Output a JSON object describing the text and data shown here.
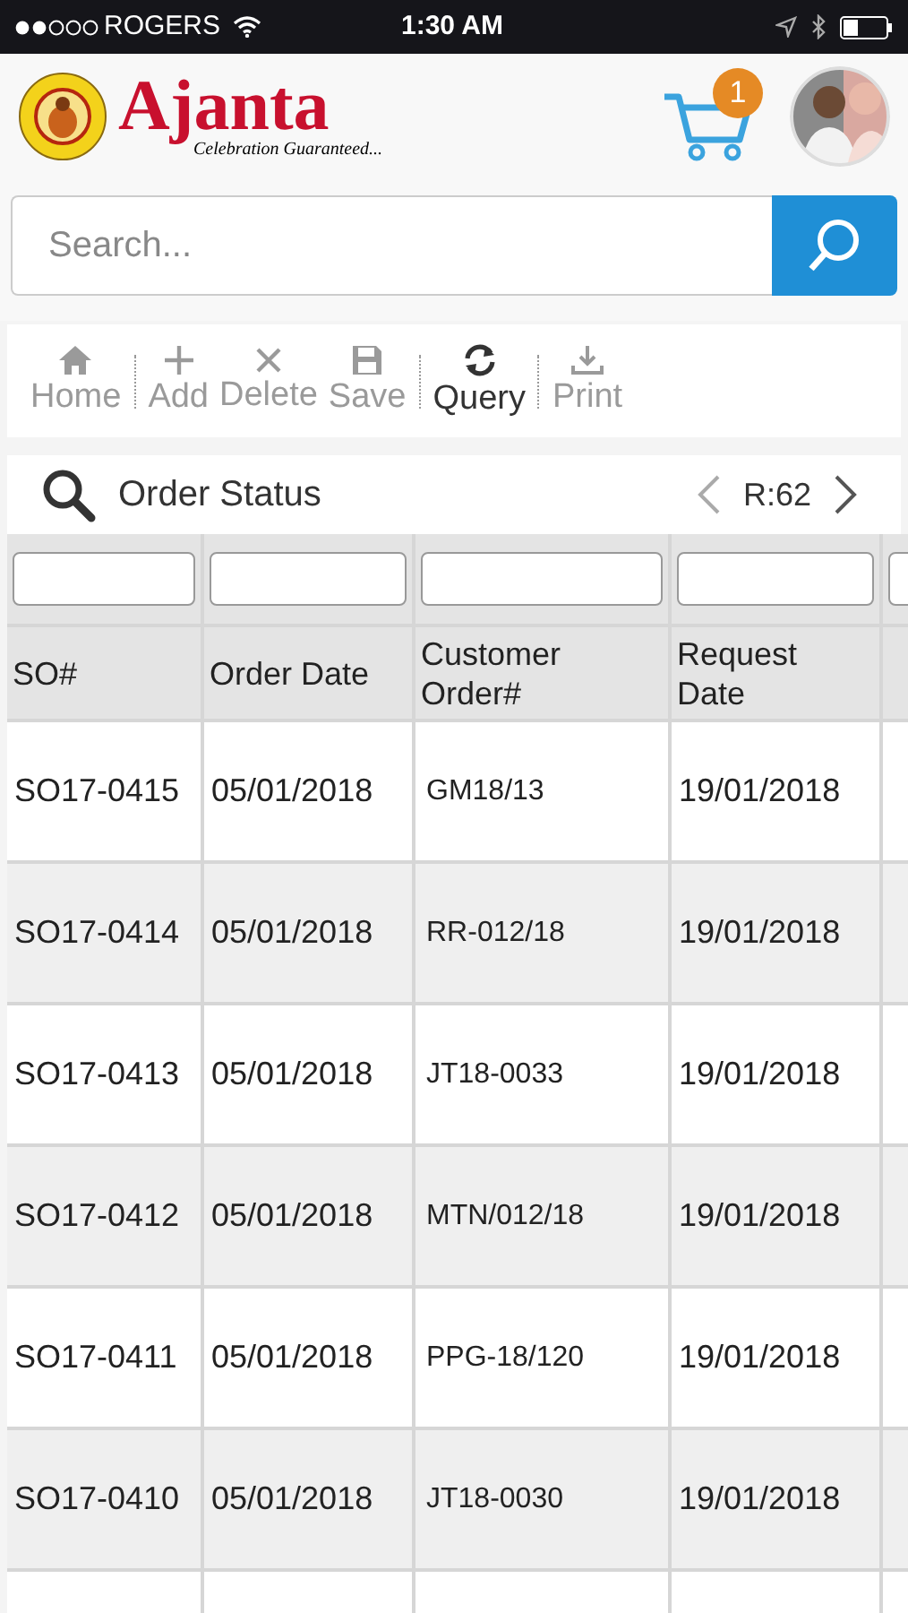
{
  "status_bar": {
    "carrier": "ROGERS",
    "time": "1:30 AM"
  },
  "header": {
    "brand": "Ajanta",
    "tagline": "Celebration Guaranteed...",
    "cart_count": "1"
  },
  "search": {
    "placeholder": "Search..."
  },
  "toolbar": [
    {
      "label": "Home",
      "kind": "home",
      "disabled": true
    },
    {
      "label": "Add",
      "kind": "add",
      "disabled": true
    },
    {
      "label": "Delete",
      "kind": "delete",
      "disabled": true
    },
    {
      "label": "Save",
      "kind": "save",
      "disabled": true
    },
    {
      "label": "Query",
      "kind": "query",
      "disabled": false
    },
    {
      "label": "Print",
      "kind": "print",
      "disabled": true
    }
  ],
  "panel": {
    "title": "Order Status",
    "record": "R:62"
  },
  "table": {
    "columns": [
      "SO#",
      "Order Date",
      "Customer Order#",
      "Request Date"
    ],
    "rows": [
      [
        "SO17-0415",
        "05/01/2018",
        "GM18/13",
        "19/01/2018"
      ],
      [
        "SO17-0414",
        "05/01/2018",
        "RR-012/18",
        "19/01/2018"
      ],
      [
        "SO17-0413",
        "05/01/2018",
        "JT18-0033",
        "19/01/2018"
      ],
      [
        "SO17-0412",
        "05/01/2018",
        "MTN/012/18",
        "19/01/2018"
      ],
      [
        "SO17-0411",
        "05/01/2018",
        "PPG-18/120",
        "19/01/2018"
      ],
      [
        "SO17-0410",
        "05/01/2018",
        "JT18-0030",
        "19/01/2018"
      ]
    ]
  }
}
